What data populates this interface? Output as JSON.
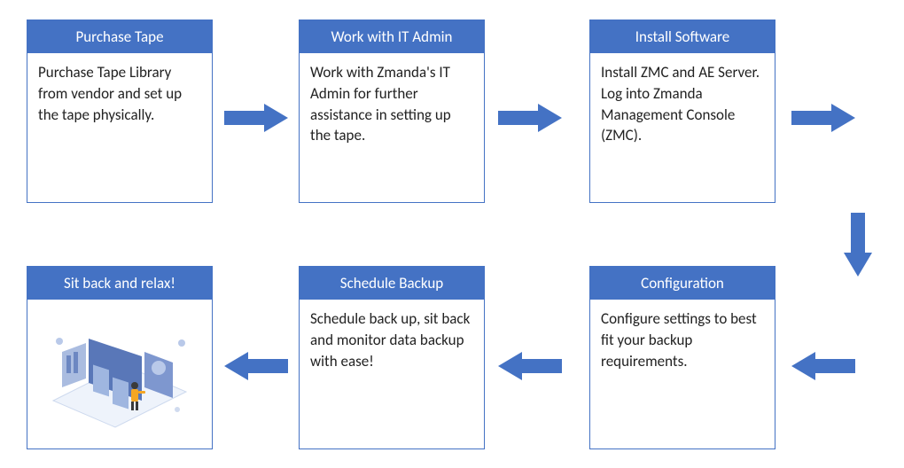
{
  "steps": [
    {
      "title": "Purchase Tape",
      "desc": "Purchase Tape Library from vendor and set up the tape physically."
    },
    {
      "title": "Work with IT Admin",
      "desc": "Work with Zmanda's  IT Admin for further assistance in setting up the tape."
    },
    {
      "title": "Install Software",
      "desc": "Install ZMC and AE Server. Log into Zmanda Management Console (ZMC)."
    },
    {
      "title": "Configuration",
      "desc": "Configure settings to best fit your backup requirements."
    },
    {
      "title": "Schedule Backup",
      "desc": "Schedule back up, sit back and monitor data backup with ease!"
    },
    {
      "title": "Sit back and relax!",
      "desc": ""
    }
  ],
  "colors": {
    "primary": "#4472c4"
  }
}
